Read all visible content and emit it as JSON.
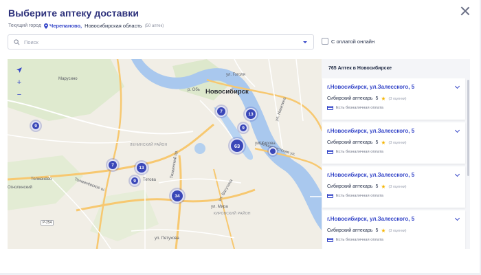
{
  "title": "Выберите аптеку доставки",
  "city": {
    "label": "Текущий город",
    "name": "Черепаново,",
    "region": "Новосибирская область",
    "count": "(50 аптек)"
  },
  "search": {
    "placeholder": "Поиск"
  },
  "online_payment": {
    "label": "С оплатой онлайн",
    "checked": false
  },
  "map": {
    "city_label": "Новосибирск",
    "labels": {
      "marusino": "Марусино",
      "tolmachevo": "Толмачёво",
      "ogno": "Огнолинский",
      "lenin_district": "ЛЕНИНСКИЙ РАЙОН",
      "kirov_district": "КИРОВСКИЙ РАЙОН",
      "gogol": "ул. Гоголя",
      "ob": "р. Обь",
      "tetiva": "Тетова",
      "kirova": "ул. Кирова",
      "tolmachevskoe": "Толмачёвское ш.",
      "tikhvinskaya": "Тихвинский пр.",
      "vatutina": "ул. Ватутина",
      "mira": "ул. Мира",
      "petukhova": "ул. Петухова",
      "bolshevistskaya": "Большевистская ул.",
      "nikitina": "ул. Никитина",
      "road": "Р-254"
    },
    "clusters": [
      "9",
      "7",
      "13",
      "9",
      "63",
      "7",
      "13",
      "9",
      "34"
    ],
    "colors": {
      "cluster": "#3a47b8",
      "water": "#a9c8ee",
      "major_road": "#f7c870"
    }
  },
  "list": {
    "header": "765 Аптек в Новосибирске",
    "items": [
      {
        "address": "г.Новосибирск, ул.Залесского, 5",
        "chain": "Сибирский аптекарь",
        "rating": "5",
        "reviews": "(3 оценки)",
        "payment": "Есть безналичная оплата"
      },
      {
        "address": "г.Новосибирск, ул.Залесского, 5",
        "chain": "Сибирский аптекарь",
        "rating": "5",
        "reviews": "(3 оценки)",
        "payment": "Есть безналичная оплата"
      },
      {
        "address": "г.Новосибирск, ул.Залесского, 5",
        "chain": "Сибирский аптекарь",
        "rating": "5",
        "reviews": "(3 оценки)",
        "payment": "Есть безналичная оплата"
      },
      {
        "address": "г.Новосибирск, ул.Залесского, 5",
        "chain": "Сибирский аптекарь",
        "rating": "5",
        "reviews": "(3 оценки)",
        "payment": "Есть безналичная оплата"
      }
    ]
  },
  "brand_color": "#3546c8"
}
